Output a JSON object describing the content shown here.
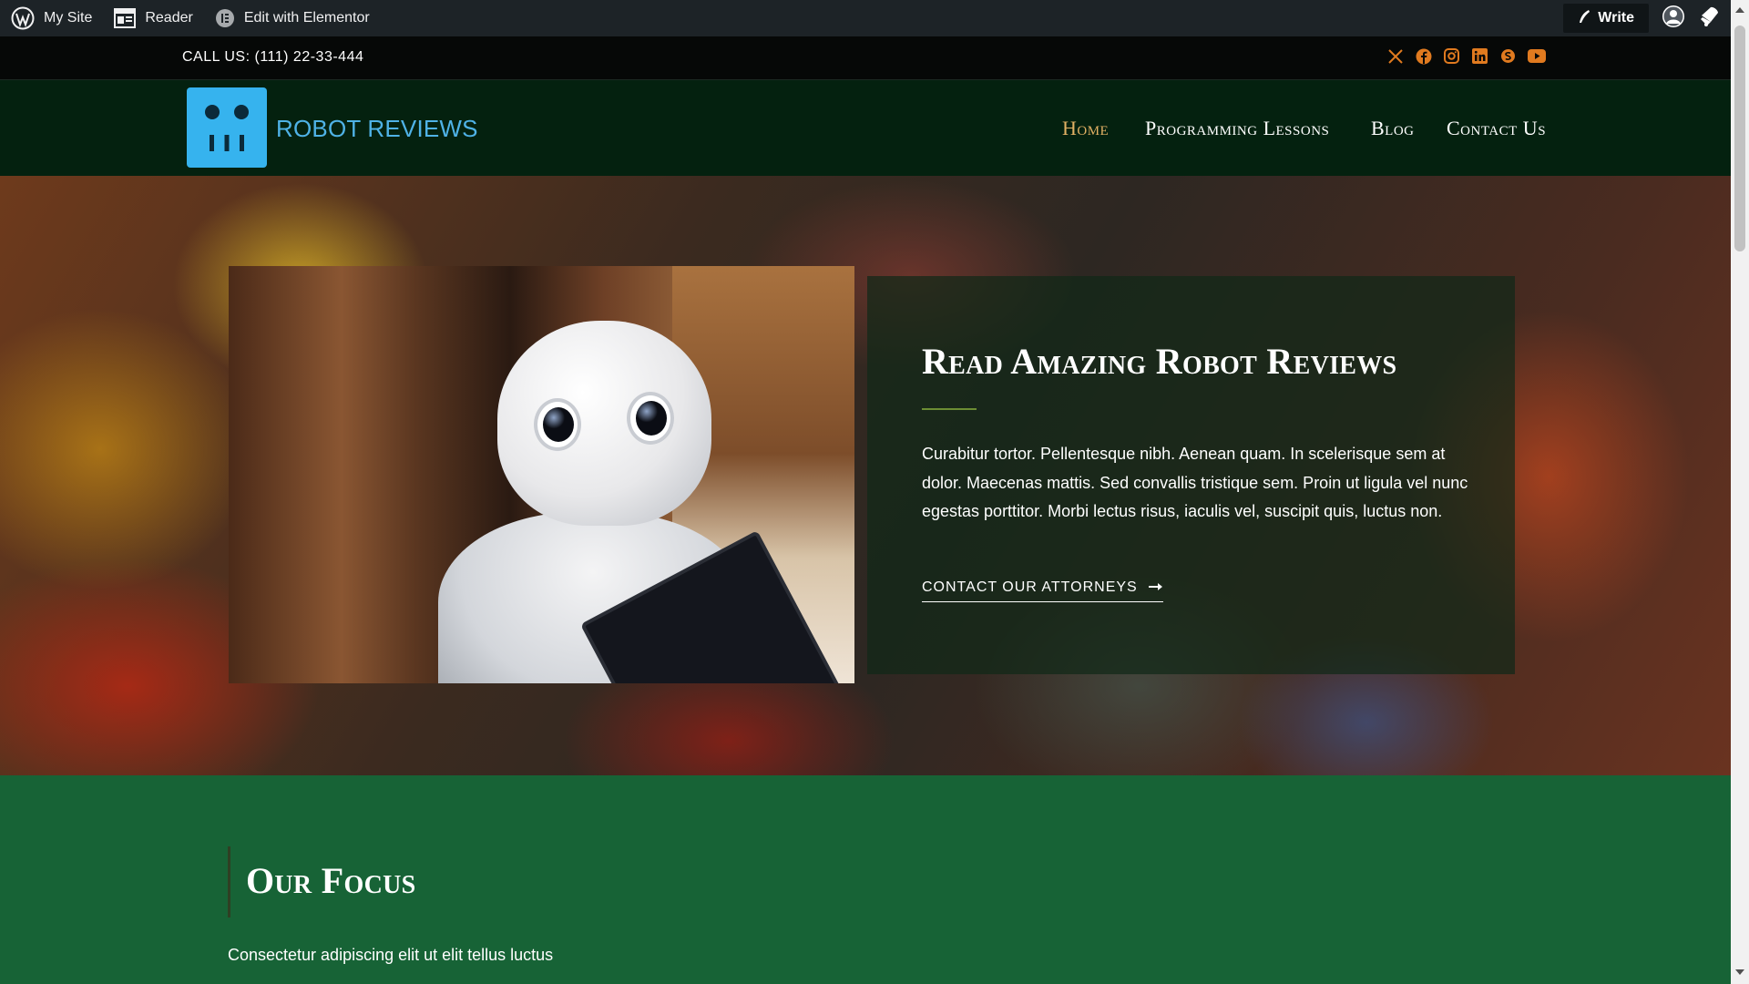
{
  "admin_bar": {
    "site_label": "My Site",
    "reader_label": "Reader",
    "elementor_label": "Edit with Elementor",
    "write_label": "Write"
  },
  "top_bar": {
    "call_text": "CALL US: (111) 22-33-444",
    "social_icons": [
      "x-icon",
      "facebook-icon",
      "instagram-icon",
      "linkedin-icon",
      "skype-icon",
      "youtube-icon"
    ],
    "social_color": "#e07a1f"
  },
  "header": {
    "logo_text": "ROBOT REVIEWS",
    "logo_color": "#36b3ee",
    "nav": [
      "Home",
      "Programming Lessons",
      "Blog",
      "Contact Us"
    ],
    "active_nav_color": "#e2b164"
  },
  "hero": {
    "heading": "Read Amazing Robot Reviews",
    "body": "Curabitur tortor. Pellentesque nibh. Aenean quam. In scelerisque sem at dolor. Maecenas mattis. Sed convallis tristique sem. Proin ut ligula vel nunc egestas porttitor. Morbi lectus risus, iaculis vel, suscipit quis, luctus non.",
    "cta_label": "CONTACT OUR ATTORNEYS"
  },
  "focus": {
    "heading": "Our Focus",
    "subtext": "Consectetur adipiscing elit ut elit tellus luctus",
    "background": "#176336"
  }
}
